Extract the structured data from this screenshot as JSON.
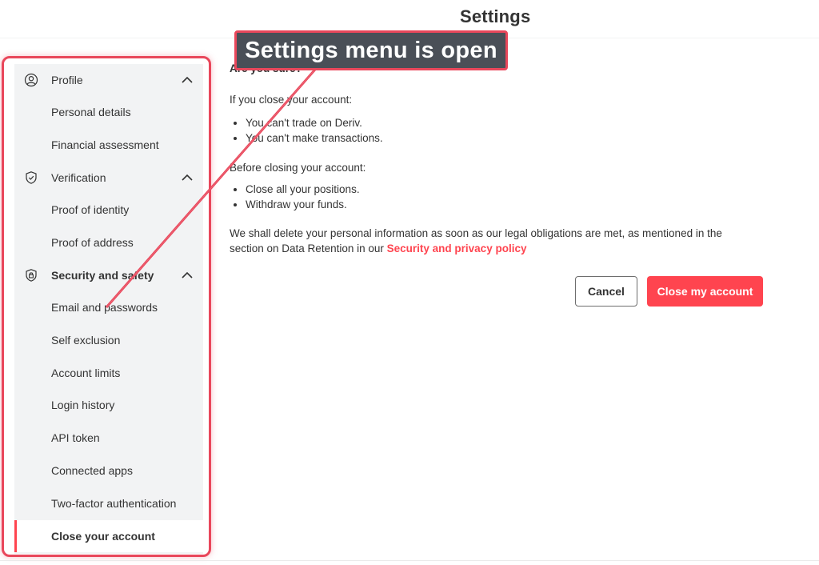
{
  "header": {
    "title": "Settings"
  },
  "annotation": {
    "callout_text": "Settings menu is open"
  },
  "sidebar": {
    "groups": [
      {
        "label": "Profile",
        "icon": "user-circle-icon",
        "items": [
          "Personal details",
          "Financial assessment"
        ]
      },
      {
        "label": "Verification",
        "icon": "shield-check-icon",
        "items": [
          "Proof of identity",
          "Proof of address"
        ]
      },
      {
        "label": "Security and safety",
        "icon": "shield-lock-icon",
        "items": [
          "Email and passwords",
          "Self exclusion",
          "Account limits",
          "Login history",
          "API token",
          "Connected apps",
          "Two-factor authentication",
          "Close your account"
        ]
      }
    ],
    "active_item": "Close your account"
  },
  "content": {
    "confirm_title": "Are you sure?",
    "if_close": "If you close your account:",
    "consequences": [
      "You can't trade on Deriv.",
      "You can't make transactions."
    ],
    "before_close": "Before closing your account:",
    "steps": [
      "Close all your positions.",
      "Withdraw your funds."
    ],
    "retention_text": "We shall delete your personal information as soon as our legal obligations are met, as mentioned in the section on Data Retention in our",
    "policy_link": "Security and privacy policy"
  },
  "buttons": {
    "cancel": "Cancel",
    "close_account": "Close my account"
  },
  "colors": {
    "accent": "#ff444f",
    "annotation_red": "#e9475b",
    "sidebar_bg": "#f2f3f4",
    "callout_bg": "#4a4f57"
  }
}
